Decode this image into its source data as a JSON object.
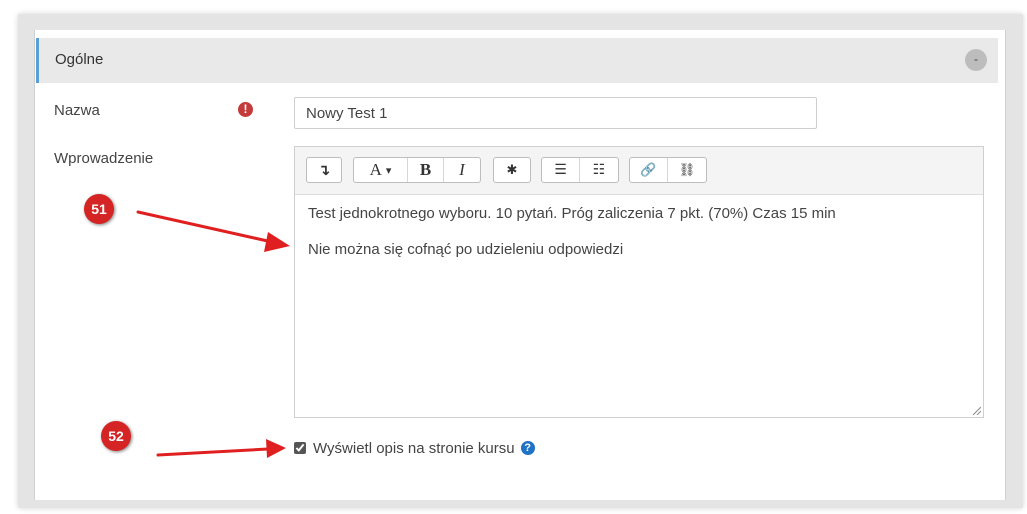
{
  "section": {
    "title": "Ogólne",
    "collapse_symbol": "-"
  },
  "name_field": {
    "label": "Nazwa",
    "required_icon": "!",
    "value": "Nowy Test 1"
  },
  "intro_field": {
    "label": "Wprowadzenie",
    "toolbar": {
      "expand_icon": "↴",
      "font_label": "A",
      "font_caret": "▾",
      "bold_label": "B",
      "italic_label": "I",
      "settings_icon": "✱",
      "bullet_list_icon": "☰",
      "numbered_list_icon": "☷",
      "link_icon": "🔗",
      "unlink_icon": "⛓"
    },
    "content": [
      "Test jednokrotnego wyboru. 10 pytań. Próg zaliczenia 7 pkt. (70%) Czas 15 min",
      "Nie można się cofnąć po udzieleniu odpowiedzi"
    ]
  },
  "show_description": {
    "label": "Wyświetl opis na stronie kursu",
    "checked": true,
    "help_icon": "?"
  },
  "annotations": {
    "marker_1": "51",
    "marker_2": "52",
    "arrow_color": "#e02020"
  },
  "colors": {
    "accent_border": "#5a9fd4",
    "required": "#c53b3b",
    "help": "#1f72c4",
    "marker": "#d42424"
  }
}
